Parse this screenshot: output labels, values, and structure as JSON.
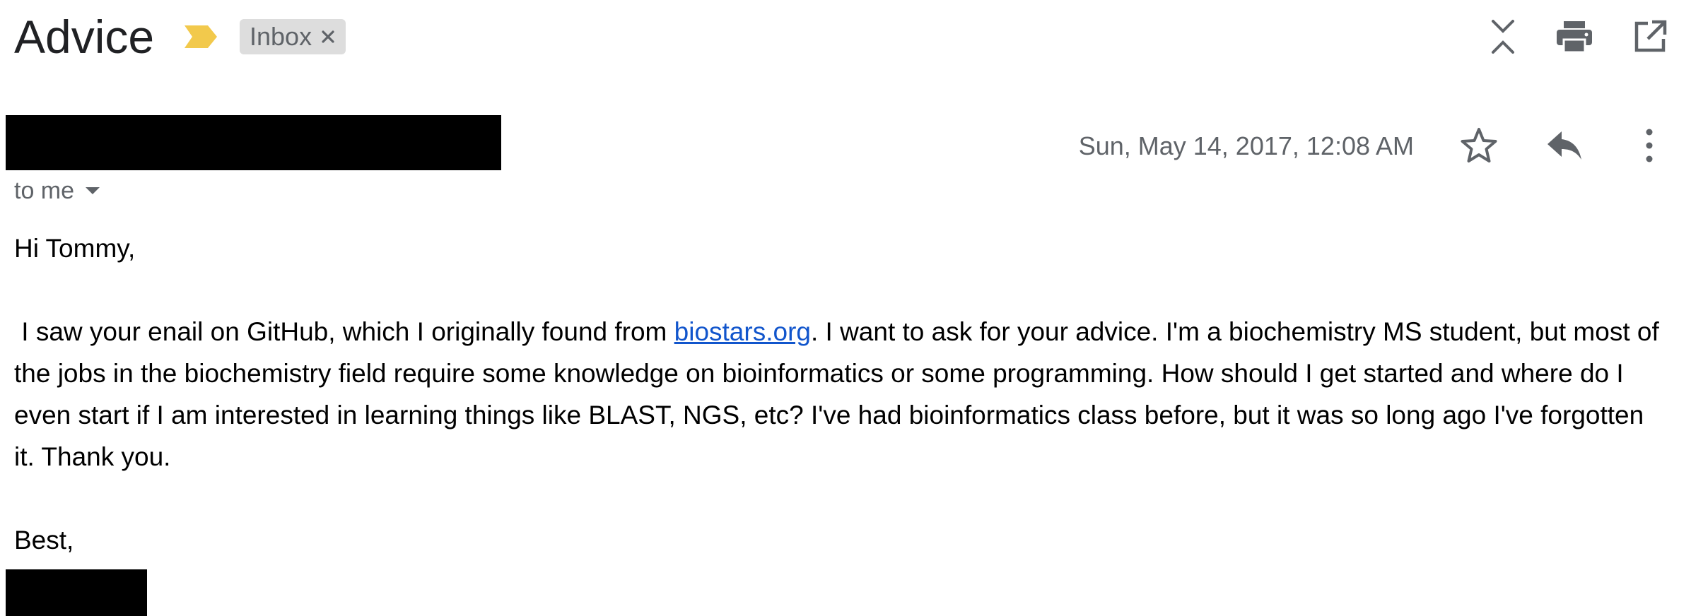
{
  "email": {
    "subject": "Advice",
    "label": "Inbox",
    "recipient": "to me",
    "date": "Sun, May 14, 2017, 12:08 AM",
    "body": {
      "greeting": "Hi Tommy,",
      "p1_before_link": "I saw your enail on GitHub, which I originally found from ",
      "link_text": "biostars.org",
      "p1_after_link": ". I want to ask for your advice. I'm a biochemistry MS student, but most of the jobs in the biochemistry field require some knowledge on bioinformatics or some programming. How should I get started and where do I even start if I am interested in learning things like BLAST, NGS, etc? I've had bioinformatics class before, but it was so long ago I've forgotten it. Thank you.",
      "closing": "Best,"
    }
  },
  "icons": {
    "importance": "importance-marker-icon",
    "remove_label": "close-icon",
    "collapse": "collapse-all-icon",
    "print": "print-icon",
    "new_window": "open-in-new-window-icon",
    "star": "star-icon",
    "reply": "reply-icon",
    "more": "more-vert-icon",
    "dropdown": "caret-down-icon"
  },
  "colors": {
    "importance": "#f2c94c",
    "link": "#1155cc",
    "chip_bg": "#dddddd",
    "secondary_text": "#5f6368",
    "icon": "#5f6368"
  }
}
